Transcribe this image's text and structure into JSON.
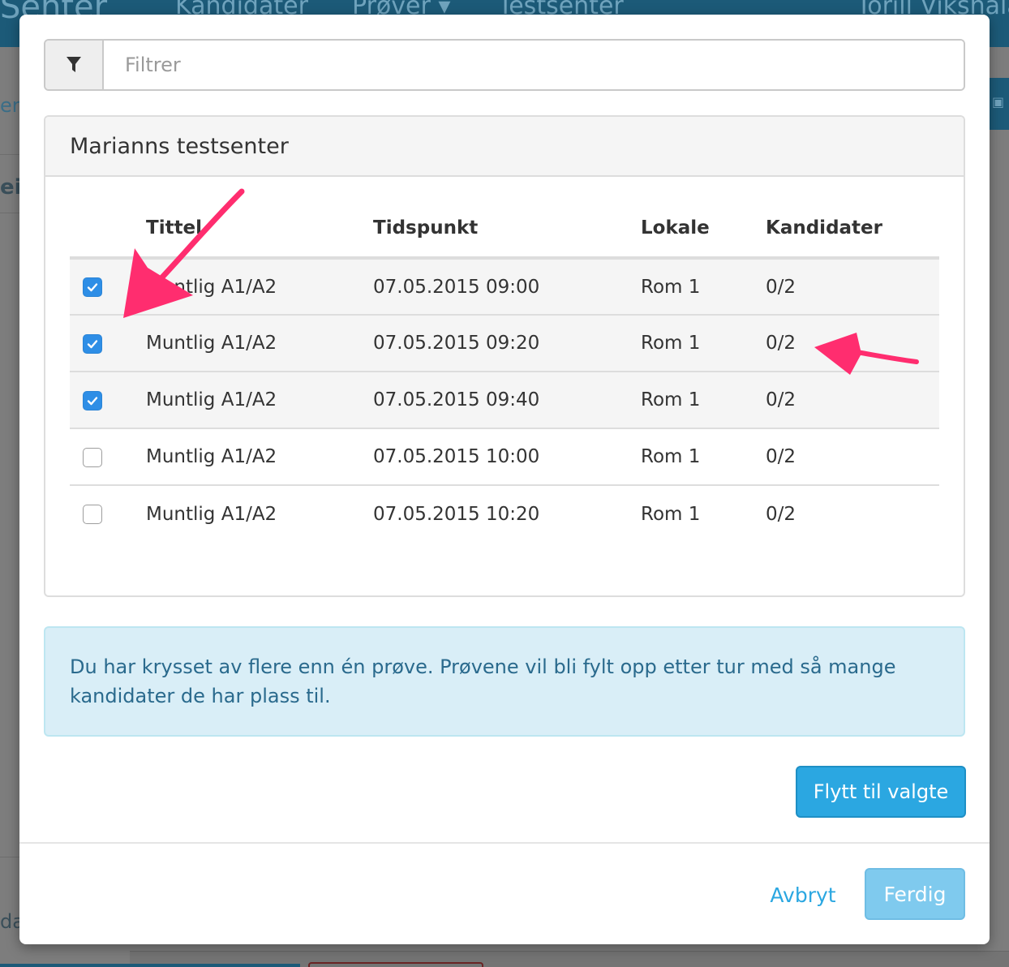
{
  "background": {
    "brand": "Senter",
    "nav_items": [
      "Kandidater",
      "Prøver",
      "Testsenter"
    ],
    "user": "Torill Vikshala",
    "left_fragments": [
      "er",
      "ei",
      "da"
    ]
  },
  "filter": {
    "icon": "filter-icon",
    "placeholder": "Filtrer",
    "value": ""
  },
  "panel": {
    "title": "Marianns testsenter"
  },
  "table": {
    "headers": {
      "title": "Tittel",
      "time": "Tidspunkt",
      "room": "Lokale",
      "candidates": "Kandidater"
    },
    "rows": [
      {
        "checked": true,
        "title": "Muntlig A1/A2",
        "time": "07.05.2015 09:00",
        "room": "Rom 1",
        "candidates": "0/2"
      },
      {
        "checked": true,
        "title": "Muntlig A1/A2",
        "time": "07.05.2015 09:20",
        "room": "Rom 1",
        "candidates": "0/2"
      },
      {
        "checked": true,
        "title": "Muntlig A1/A2",
        "time": "07.05.2015 09:40",
        "room": "Rom 1",
        "candidates": "0/2"
      },
      {
        "checked": false,
        "title": "Muntlig A1/A2",
        "time": "07.05.2015 10:00",
        "room": "Rom 1",
        "candidates": "0/2"
      },
      {
        "checked": false,
        "title": "Muntlig A1/A2",
        "time": "07.05.2015 10:20",
        "room": "Rom 1",
        "candidates": "0/2"
      }
    ]
  },
  "alert": {
    "text": "Du har krysset av flere enn én prøve. Prøvene vil bli fylt opp etter tur med så mange kandidater de har plass til."
  },
  "buttons": {
    "move": "Flytt til valgte",
    "cancel": "Avbryt",
    "done": "Ferdig"
  },
  "colors": {
    "primary": "#2ba7e1",
    "checkbox_checked": "#2e8ee6",
    "alert_bg": "#d9eef7",
    "alert_text": "#2a6a8d",
    "annotation_arrow": "#ff2d6f"
  }
}
